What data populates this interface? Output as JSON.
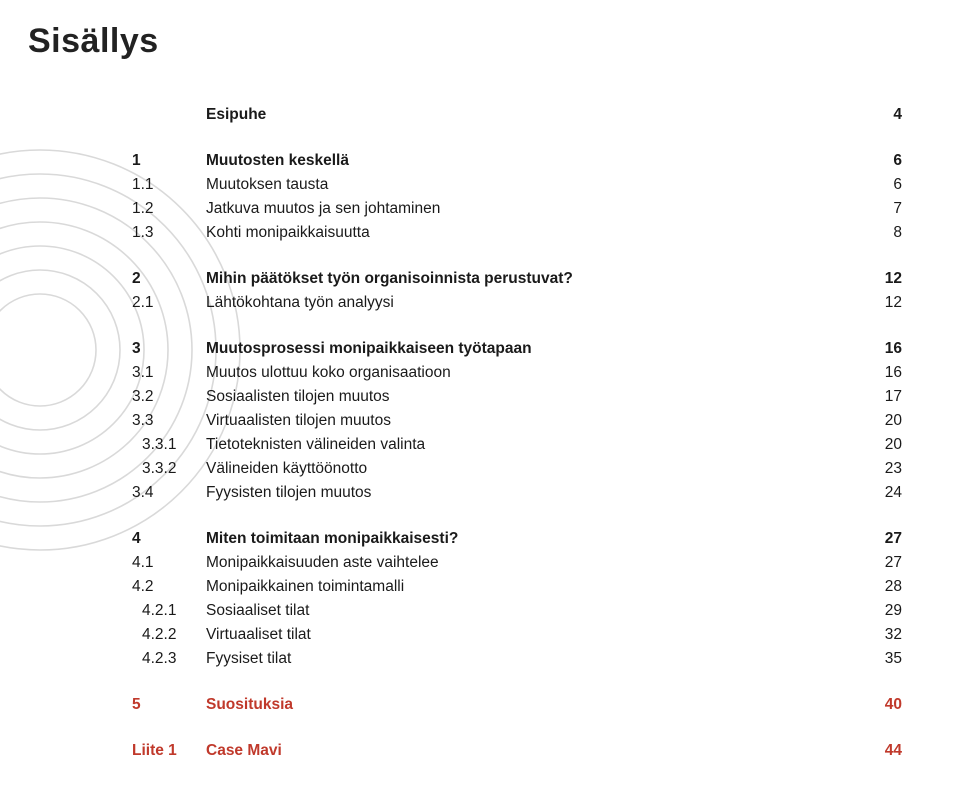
{
  "title": "Sisällys",
  "toc": {
    "esipuhe": {
      "num": "",
      "text": "Esipuhe",
      "page": "4"
    },
    "s1": {
      "num": "1",
      "text": "Muutosten keskellä",
      "page": "6"
    },
    "s11": {
      "num": "1.1",
      "text": "Muutoksen tausta",
      "page": "6"
    },
    "s12": {
      "num": "1.2",
      "text": "Jatkuva muutos ja sen johtaminen",
      "page": "7"
    },
    "s13": {
      "num": "1.3",
      "text": "Kohti monipaikkaisuutta",
      "page": "8"
    },
    "s2": {
      "num": "2",
      "text": "Mihin päätökset työn organisoinnista perustuvat?",
      "page": "12"
    },
    "s21": {
      "num": "2.1",
      "text": "Lähtökohtana työn analyysi",
      "page": "12"
    },
    "s3": {
      "num": "3",
      "text": "Muutosprosessi monipaikkaiseen työtapaan",
      "page": "16"
    },
    "s31": {
      "num": "3.1",
      "text": "Muutos ulottuu koko organisaatioon",
      "page": "16"
    },
    "s32": {
      "num": "3.2",
      "text": "Sosiaalisten tilojen muutos",
      "page": "17"
    },
    "s33": {
      "num": "3.3",
      "text": "Virtuaalisten tilojen muutos",
      "page": "20"
    },
    "s331": {
      "num": "3.3.1",
      "text": "Tietoteknisten välineiden valinta",
      "page": "20"
    },
    "s332": {
      "num": "3.3.2",
      "text": "Välineiden käyttöönotto",
      "page": "23"
    },
    "s34": {
      "num": "3.4",
      "text": "Fyysisten tilojen muutos",
      "page": "24"
    },
    "s4": {
      "num": "4",
      "text": "Miten toimitaan monipaikkaisesti?",
      "page": "27"
    },
    "s41": {
      "num": "4.1",
      "text": "Monipaikkaisuuden aste vaihtelee",
      "page": "27"
    },
    "s42": {
      "num": "4.2",
      "text": "Monipaikkainen toimintamalli",
      "page": "28"
    },
    "s421": {
      "num": "4.2.1",
      "text": "Sosiaaliset tilat",
      "page": "29"
    },
    "s422": {
      "num": "4.2.2",
      "text": "Virtuaaliset tilat",
      "page": "32"
    },
    "s423": {
      "num": "4.2.3",
      "text": "Fyysiset tilat",
      "page": "35"
    },
    "s5": {
      "num": "5",
      "text": "Suosituksia",
      "page": "40"
    },
    "liite": {
      "num": "Liite 1",
      "text": "Case Mavi",
      "page": "44"
    }
  }
}
